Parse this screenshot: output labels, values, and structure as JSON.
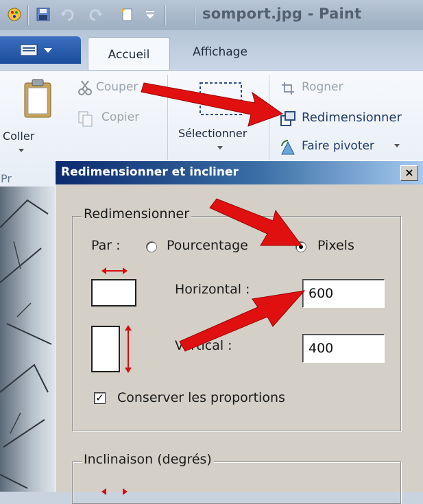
{
  "window": {
    "title": "somport.jpg - Paint"
  },
  "tabs": [
    {
      "label": "Accueil",
      "active": true
    },
    {
      "label": "Affichage",
      "active": false
    }
  ],
  "ribbon": {
    "paste_label": "Coller",
    "cut_label": "Couper",
    "copy_label": "Copier",
    "group_label_partial": "Pr",
    "select_label": "Sélectionner",
    "crop_label": "Rogner",
    "resize_label": "Redimensionner",
    "rotate_label": "Faire pivoter"
  },
  "dialog": {
    "title": "Redimensionner et incliner",
    "close_glyph": "×",
    "resize_group": {
      "label": "Redimensionner",
      "by_label": "Par :",
      "options": [
        {
          "label": "Pourcentage",
          "selected": false
        },
        {
          "label": "Pixels",
          "selected": true
        }
      ],
      "horizontal_label": "Horizontal :",
      "horizontal_value": "600",
      "vertical_label": "Vertical :",
      "vertical_value": "400",
      "keep_ratio_label": "Conserver les proportions",
      "keep_ratio_checked": true
    },
    "skew_group": {
      "label": "Inclinaison (degrés)"
    }
  },
  "colors": {
    "annotation_arrow": "#e01010",
    "title_gradient_start": "#0b2a6e",
    "title_gradient_end": "#a6caf0",
    "dialog_face": "#d4d0c8"
  }
}
